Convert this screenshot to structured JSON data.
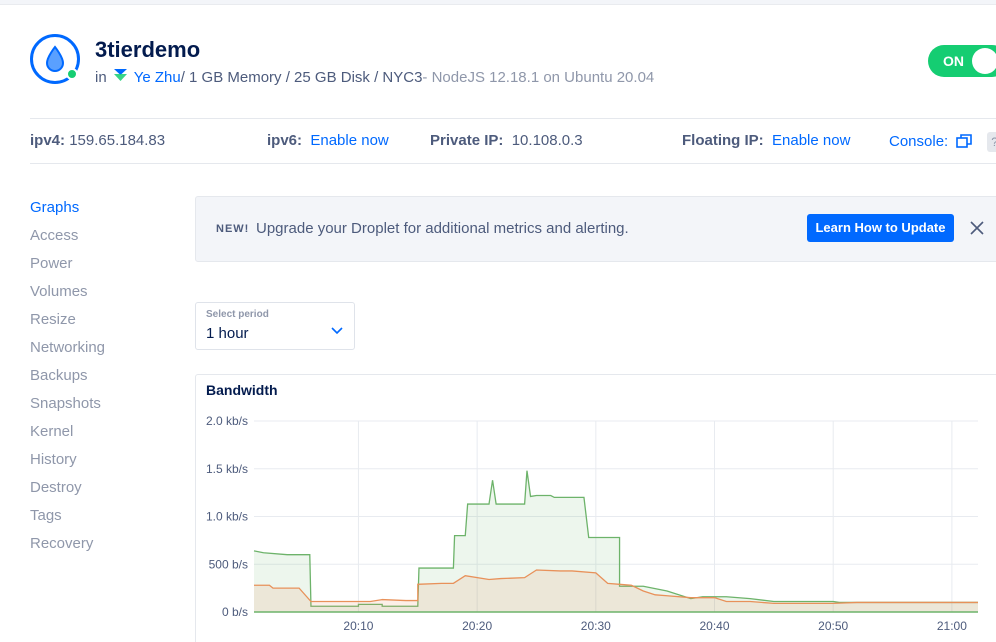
{
  "droplet": {
    "name": "3tierdemo",
    "in_label": "in",
    "team": "Ye Zhu",
    "specs": " / 1 GB Memory / 25 GB Disk / NYC3",
    "image": " - NodeJS 12.18.1 on Ubuntu 20.04",
    "power_label": "ON"
  },
  "network": {
    "ipv4_label": "ipv4:",
    "ipv4_value": "159.65.184.83",
    "ipv6_label": "ipv6:",
    "ipv6_value": "Enable now",
    "private_label": "Private IP:",
    "private_value": "10.108.0.3",
    "floating_label": "Floating IP:",
    "floating_value": "Enable now",
    "console_label": "Console:",
    "help_label": "?"
  },
  "sidebar": {
    "items": [
      {
        "label": "Graphs",
        "active": true
      },
      {
        "label": "Access"
      },
      {
        "label": "Power"
      },
      {
        "label": "Volumes"
      },
      {
        "label": "Resize"
      },
      {
        "label": "Networking"
      },
      {
        "label": "Backups"
      },
      {
        "label": "Snapshots"
      },
      {
        "label": "Kernel"
      },
      {
        "label": "History"
      },
      {
        "label": "Destroy"
      },
      {
        "label": "Tags"
      },
      {
        "label": "Recovery"
      }
    ]
  },
  "banner": {
    "new_label": "NEW!",
    "message": "Upgrade your Droplet for additional metrics and alerting.",
    "button_label": "Learn How to Update"
  },
  "period": {
    "caption": "Select period",
    "value": "1 hour"
  },
  "colors": {
    "accent": "#0069ff",
    "on_green": "#15cd72",
    "inbound": "#6db36a",
    "outbound": "#e8915a"
  },
  "chart_data": {
    "type": "area",
    "title": "Bandwidth",
    "y_ticks": [
      "2.0 kb/s",
      "1.5 kb/s",
      "1.0 kb/s",
      "500 b/s",
      "0 b/s"
    ],
    "x_ticks": [
      "20:10",
      "20:20",
      "20:30",
      "20:40",
      "20:50",
      "21:00"
    ],
    "ylim": [
      0,
      2000
    ],
    "x_unit": "minutes after 20:00",
    "xlim": [
      1.2,
      62.2
    ],
    "grid": true,
    "series": [
      {
        "color": "#6db36a",
        "points": [
          [
            1.2,
            640
          ],
          [
            2,
            620
          ],
          [
            4,
            600
          ],
          [
            4.5,
            600
          ],
          [
            5.9,
            600
          ],
          [
            6,
            60
          ],
          [
            10,
            60
          ],
          [
            10,
            80
          ],
          [
            12,
            80
          ],
          [
            12,
            60
          ],
          [
            13,
            60
          ],
          [
            15,
            60
          ],
          [
            15.1,
            460
          ],
          [
            16,
            460
          ],
          [
            17,
            460
          ],
          [
            18,
            460
          ],
          [
            18.1,
            800
          ],
          [
            19,
            800
          ],
          [
            19.2,
            1130
          ],
          [
            21,
            1130
          ],
          [
            21.3,
            1380
          ],
          [
            21.6,
            1130
          ],
          [
            22,
            1130
          ],
          [
            24,
            1130
          ],
          [
            24.2,
            1480
          ],
          [
            24.5,
            1210
          ],
          [
            25,
            1220
          ],
          [
            26.2,
            1220
          ],
          [
            26.5,
            1200
          ],
          [
            28,
            1200
          ],
          [
            29,
            1200
          ],
          [
            29.4,
            780
          ],
          [
            31,
            780
          ],
          [
            32,
            780
          ],
          [
            32,
            270
          ],
          [
            34,
            270
          ],
          [
            36,
            220
          ],
          [
            38,
            140
          ],
          [
            39,
            160
          ],
          [
            41,
            160
          ],
          [
            43,
            140
          ],
          [
            45,
            110
          ],
          [
            50,
            110
          ],
          [
            50.5,
            100
          ],
          [
            52,
            100
          ],
          [
            60,
            100
          ],
          [
            61,
            100
          ],
          [
            62,
            100
          ],
          [
            62.2,
            100
          ]
        ],
        "notes": "inbound"
      },
      {
        "color": "#e8915a",
        "points": [
          [
            1.2,
            280
          ],
          [
            2.5,
            280
          ],
          [
            2.8,
            250
          ],
          [
            5,
            250
          ],
          [
            6,
            110
          ],
          [
            11,
            110
          ],
          [
            12,
            130
          ],
          [
            14,
            120
          ],
          [
            15,
            120
          ],
          [
            15,
            290
          ],
          [
            17,
            300
          ],
          [
            18,
            300
          ],
          [
            19,
            380
          ],
          [
            21,
            340
          ],
          [
            22,
            350
          ],
          [
            24,
            360
          ],
          [
            25,
            440
          ],
          [
            27,
            430
          ],
          [
            28,
            430
          ],
          [
            30,
            410
          ],
          [
            31,
            300
          ],
          [
            32,
            290
          ],
          [
            33,
            280
          ],
          [
            34,
            220
          ],
          [
            35,
            180
          ],
          [
            36,
            170
          ],
          [
            38,
            150
          ],
          [
            40,
            150
          ],
          [
            41,
            110
          ],
          [
            43,
            110
          ],
          [
            45,
            90
          ],
          [
            50,
            90
          ],
          [
            52,
            100
          ],
          [
            56,
            100
          ],
          [
            62,
            100
          ],
          [
            62.2,
            100
          ]
        ],
        "notes": "outbound"
      }
    ]
  }
}
